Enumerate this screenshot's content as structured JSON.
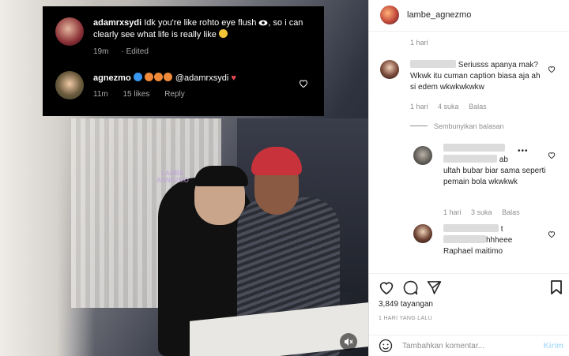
{
  "overlay": {
    "comment1": {
      "username": "adamrxsydi",
      "text_a": "Idk you're like rohto eye flush",
      "text_b": ", so i can clearly see what life is really like",
      "time": "19m",
      "edited": "Edited"
    },
    "comment2": {
      "username": "agnezmo",
      "mention": "@adamrxsydi",
      "time": "11m",
      "likes": "15 likes",
      "reply": "Reply"
    }
  },
  "watermark": "LAMBE\nAGNEZMO",
  "post": {
    "username": "lambe_agnezmo",
    "time": "1 hari",
    "views": "3,849 tayangan",
    "date": "1 HARI YANG LALU"
  },
  "comments": [
    {
      "text": "Seriusss apanya mak? Wkwk itu cuman caption biasa aja ah si edem wkwkwkwkw",
      "time": "1 hari",
      "likes": "4 suka",
      "reply": "Balas"
    }
  ],
  "hide_replies": "Sembunyikan balasan",
  "replies": [
    {
      "text_suffix": "ab",
      "text": "ultah bubar biar sama seperti pemain bola wkwkwk",
      "time": "1 hari",
      "likes": "3 suka",
      "reply": "Balas"
    },
    {
      "text_suffix": "t",
      "text_line2": "hhheee",
      "text_line3": "Raphael maitimo"
    }
  ],
  "add_comment": {
    "placeholder": "Tambahkan komentar...",
    "post_label": "Kirim"
  },
  "colors": {
    "accent": "#3897f0",
    "like_red": "#ed4956",
    "post_disabled": "#b2dffc"
  }
}
